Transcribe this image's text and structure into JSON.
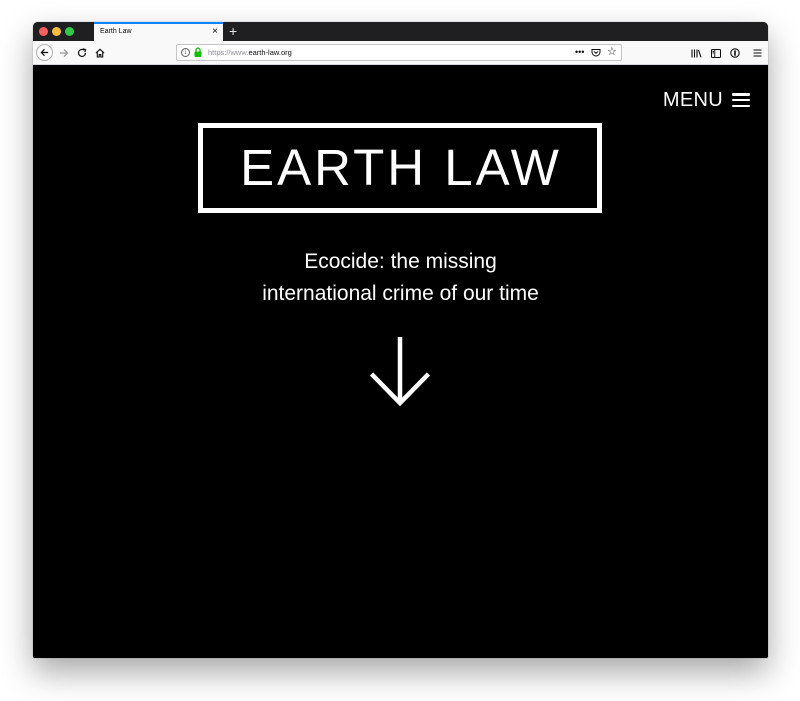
{
  "browser": {
    "tab_title": "Earth Law",
    "tab_close": "×",
    "new_tab": "+",
    "url_protocol": "https://www.",
    "url_domain": "earth-law.org",
    "info_glyph": "i",
    "more_glyph": "•••",
    "star_glyph": "☆",
    "icons": {
      "back": "back-arrow-icon",
      "forward": "forward-arrow-icon",
      "reload": "reload-icon",
      "home": "home-icon",
      "lock": "lock-icon",
      "pocket": "pocket-icon",
      "library": "library-icon",
      "sidebar": "sidebar-icon",
      "account": "account-icon",
      "hamburger": "hamburger-menu-icon"
    },
    "colors": {
      "tab_accent": "#0a84ff",
      "lock_green": "#12bc00",
      "close_red": "#fc605c",
      "minimize_yellow": "#fdbc40",
      "zoom_green": "#34c84a"
    }
  },
  "site": {
    "menu_label": "MENU",
    "logo_text": "EARTH LAW",
    "tagline_line1": "Ecocide: the missing",
    "tagline_line2": "international crime of our time",
    "colors": {
      "background": "#000000",
      "foreground": "#ffffff"
    }
  }
}
